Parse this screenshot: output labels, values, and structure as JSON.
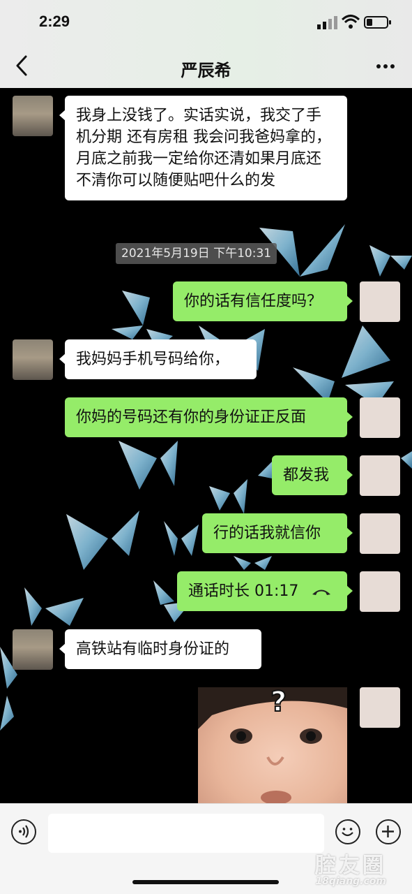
{
  "status_bar": {
    "time": "2:29"
  },
  "header": {
    "title": "严辰希"
  },
  "timestamp": "2021年5月19日 下午10:31",
  "messages": [
    {
      "side": "in",
      "text": "我身上没钱了。实话实说，我交了手机分期  还有房租  我会问我爸妈拿的，月底之前我一定给你还清如果月底还不清你可以随便贴吧什么的发"
    },
    {
      "side": "out",
      "text": "你的话有信任度吗？"
    },
    {
      "side": "in",
      "text": "我妈妈手机号码给你，"
    },
    {
      "side": "out",
      "text": "你妈的号码还有你的身份证正反面"
    },
    {
      "side": "out",
      "text": "都发我"
    },
    {
      "side": "out",
      "text": "行的话我就信你"
    },
    {
      "side": "out",
      "text": "通话时长 01:17",
      "icon": "hangup-phone-icon"
    },
    {
      "side": "in",
      "text": "高铁站有临时身份证的"
    },
    {
      "side": "out",
      "type": "sticker",
      "text": "?"
    }
  ],
  "input_bar": {
    "placeholder": ""
  },
  "watermark": {
    "cn": "腔友圈",
    "url": "18qiang.com"
  },
  "colors": {
    "outgoing_bubble": "#95ec69",
    "incoming_bubble": "#ffffff",
    "chat_background": "#000000"
  }
}
